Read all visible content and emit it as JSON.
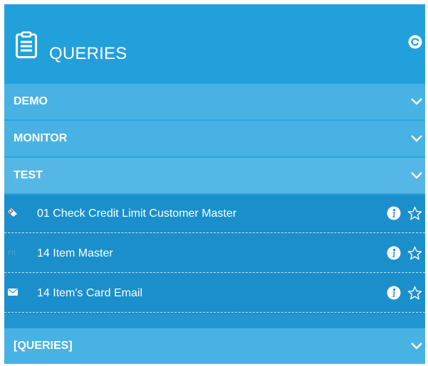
{
  "header": {
    "title": "QUERIES",
    "icon": "document-list-icon",
    "action_icon": "refresh-icon"
  },
  "sections": [
    {
      "label": "DEMO",
      "expanded": false
    },
    {
      "label": "MONITOR",
      "expanded": false
    },
    {
      "label": "TEST",
      "expanded": true
    },
    {
      "label": "[QUERIES]",
      "expanded": false
    }
  ],
  "test_items": [
    {
      "label": "01 Check Credit Limit Customer Master",
      "icon": "tag-icon"
    },
    {
      "label": "14 Item Master",
      "icon": "faded-item-icon"
    },
    {
      "label": "14 Item's Card Email",
      "icon": "mail-icon"
    }
  ],
  "colors": {
    "header_bg": "#22a0dc",
    "section_bg": "#48b2e4",
    "item_bg": "#1b8fcb",
    "text": "#ffffff"
  }
}
